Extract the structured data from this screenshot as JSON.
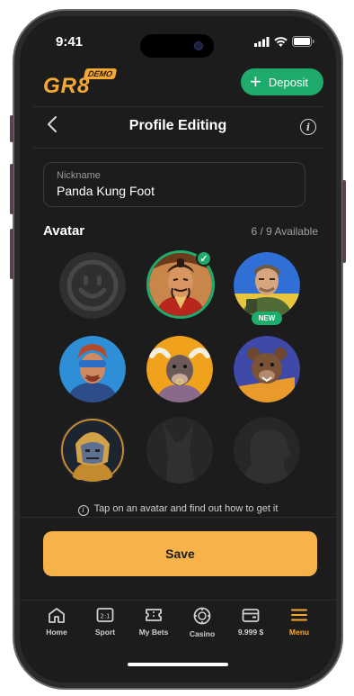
{
  "status": {
    "time": "9:41"
  },
  "header": {
    "logo": "GR8",
    "demo_badge": "DEMO",
    "deposit_label": "Deposit"
  },
  "page": {
    "title": "Profile Editing"
  },
  "nickname": {
    "label": "Nickname",
    "value": "Panda Kung Foot"
  },
  "avatars": {
    "title": "Avatar",
    "available": "6 / 9 Available",
    "new_badge": "NEW",
    "hint": "Tap on an avatar and find out how to get it"
  },
  "save_label": "Save",
  "nav": {
    "items": [
      {
        "label": "Home",
        "icon": "home-icon"
      },
      {
        "label": "Sport",
        "icon": "sport-icon"
      },
      {
        "label": "My Bets",
        "icon": "ticket-icon"
      },
      {
        "label": "Casino",
        "icon": "casino-chip-icon"
      },
      {
        "label": "9.999 $",
        "icon": "wallet-icon"
      },
      {
        "label": "Menu",
        "icon": "menu-icon"
      }
    ]
  },
  "colors": {
    "accent": "#f7a833",
    "success": "#1eab6b",
    "background": "#1c1c1c"
  }
}
